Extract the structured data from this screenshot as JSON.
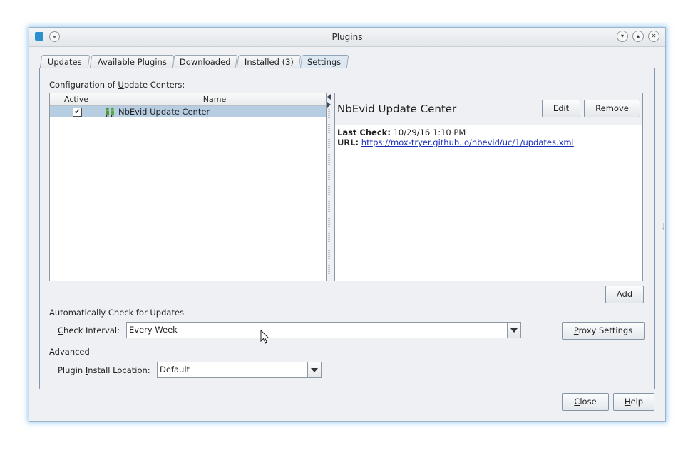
{
  "window": {
    "title": "Plugins"
  },
  "tabs": [
    {
      "label": "Updates"
    },
    {
      "label": "Available Plugins"
    },
    {
      "label": "Downloaded"
    },
    {
      "label": "Installed (3)"
    },
    {
      "label": "Settings",
      "active": true
    }
  ],
  "settings": {
    "config_prefix": "Configuration of ",
    "config_mnemonic": "U",
    "config_suffix": "pdate Centers:",
    "table": {
      "columns": [
        "Active",
        "Name"
      ],
      "rows": [
        {
          "active": true,
          "check_glyph": "✔",
          "name": "NbEvid Update Center",
          "icon": "people-icon"
        }
      ]
    },
    "detail": {
      "title": "NbEvid Update Center",
      "last_check_label": "Last Check:",
      "last_check_value": "10/29/16 1:10 PM",
      "url_label": "URL:",
      "url_value": "https://mox-tryer.github.io/nbevid/uc/1/updates.xml",
      "edit_mn": "E",
      "edit_rest": "dit",
      "remove_mn": "R",
      "remove_rest": "emove"
    },
    "add_label": "Add",
    "auto_check_heading": "Automatically Check for Updates",
    "check_interval_mn": "C",
    "check_interval_rest": "heck Interval:",
    "check_interval_value": "Every Week",
    "proxy_mn": "P",
    "proxy_rest": "roxy Settings",
    "advanced_heading": "Advanced",
    "install_loc_a": "Plugin ",
    "install_loc_mn": "I",
    "install_loc_rest": "nstall Location:",
    "install_loc_value": "Default"
  },
  "footer": {
    "close_mn": "C",
    "close_rest": "lose",
    "help_mn": "H",
    "help_rest": "elp"
  },
  "colors": {
    "selection": "#b7cde2",
    "link": "#1a2fb5",
    "panel_border": "#7f97b0",
    "window_glow": "#5aaae6"
  }
}
